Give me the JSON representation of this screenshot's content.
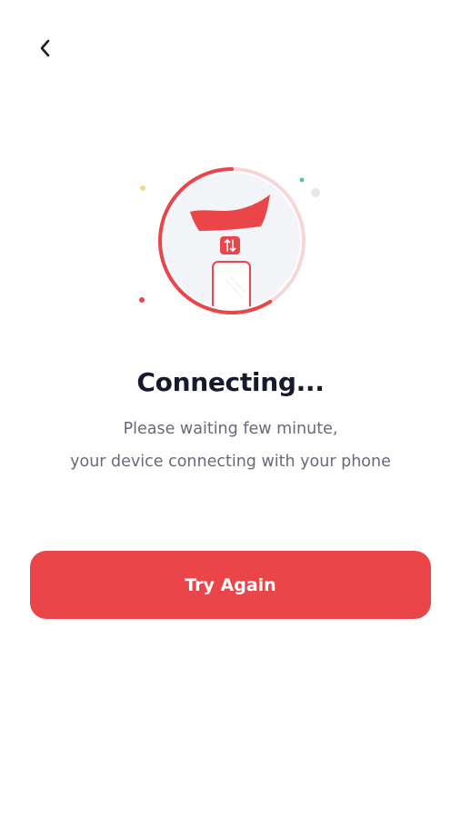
{
  "header": {
    "back_icon": "chevron-left-icon"
  },
  "illustration": {
    "icons": [
      "shoe-icon",
      "sync-arrows-icon",
      "phone-icon"
    ],
    "colors": {
      "accent": "#EA4549",
      "ring_light": "#F7D6D7",
      "circle_fill": "#F4F5F9"
    }
  },
  "status": {
    "title": "Connecting...",
    "message_line1": "Please waiting few minute,",
    "message_line2": "your device connecting with your phone"
  },
  "actions": {
    "try_again_label": "Try Again"
  },
  "colors": {
    "primary": "#EA4549",
    "text_dark": "#161A2C",
    "text_muted": "#676A78",
    "background": "#FFFFFF"
  }
}
